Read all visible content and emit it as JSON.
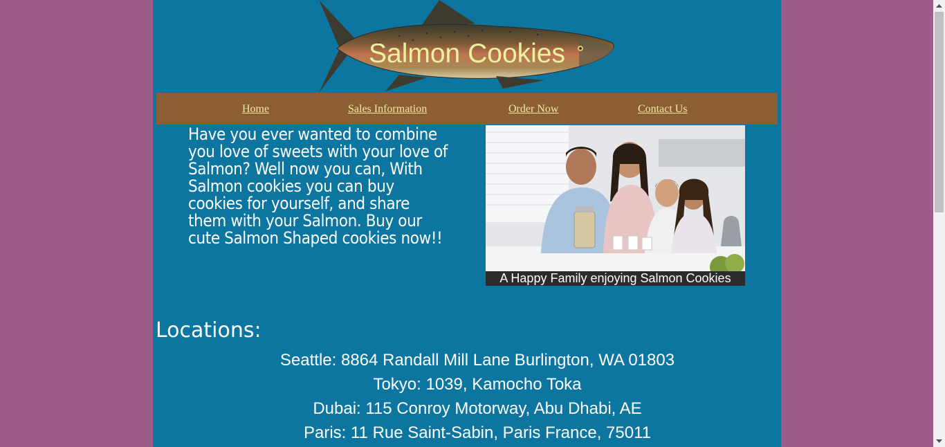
{
  "header": {
    "title": "Salmon Cookies",
    "logo_icon": "salmon-fish-icon"
  },
  "nav": {
    "items": [
      {
        "label": "Home"
      },
      {
        "label": "Sales Information"
      },
      {
        "label": "Order Now"
      },
      {
        "label": "Contact Us"
      }
    ]
  },
  "main": {
    "intro": "Have you ever wanted to combine you love of sweets with your love of Salmon? Well now you can, With Salmon cookies you can buy cookies for yourself, and share them with your Salmon. Buy our cute Salmon Shaped cookies now!!",
    "photo_caption": "A Happy Family enjoying Salmon Cookies"
  },
  "locations": {
    "heading": "Locations:",
    "items": [
      "Seattle: 8864 Randall Mill Lane Burlington, WA 01803",
      "Tokyo: 1039, Kamocho Toka",
      "Dubai: 115 Conroy Motorway, Abu Dhabi, AE",
      "Paris: 11 Rue Saint-Sabin, Paris France, 75011"
    ]
  },
  "colors": {
    "page_bg": "#9c5c87",
    "content_bg": "#0c76a0",
    "nav_bg": "#8c5e34",
    "title_color": "#e8f2a0",
    "link_color": "#f0eaa0"
  }
}
